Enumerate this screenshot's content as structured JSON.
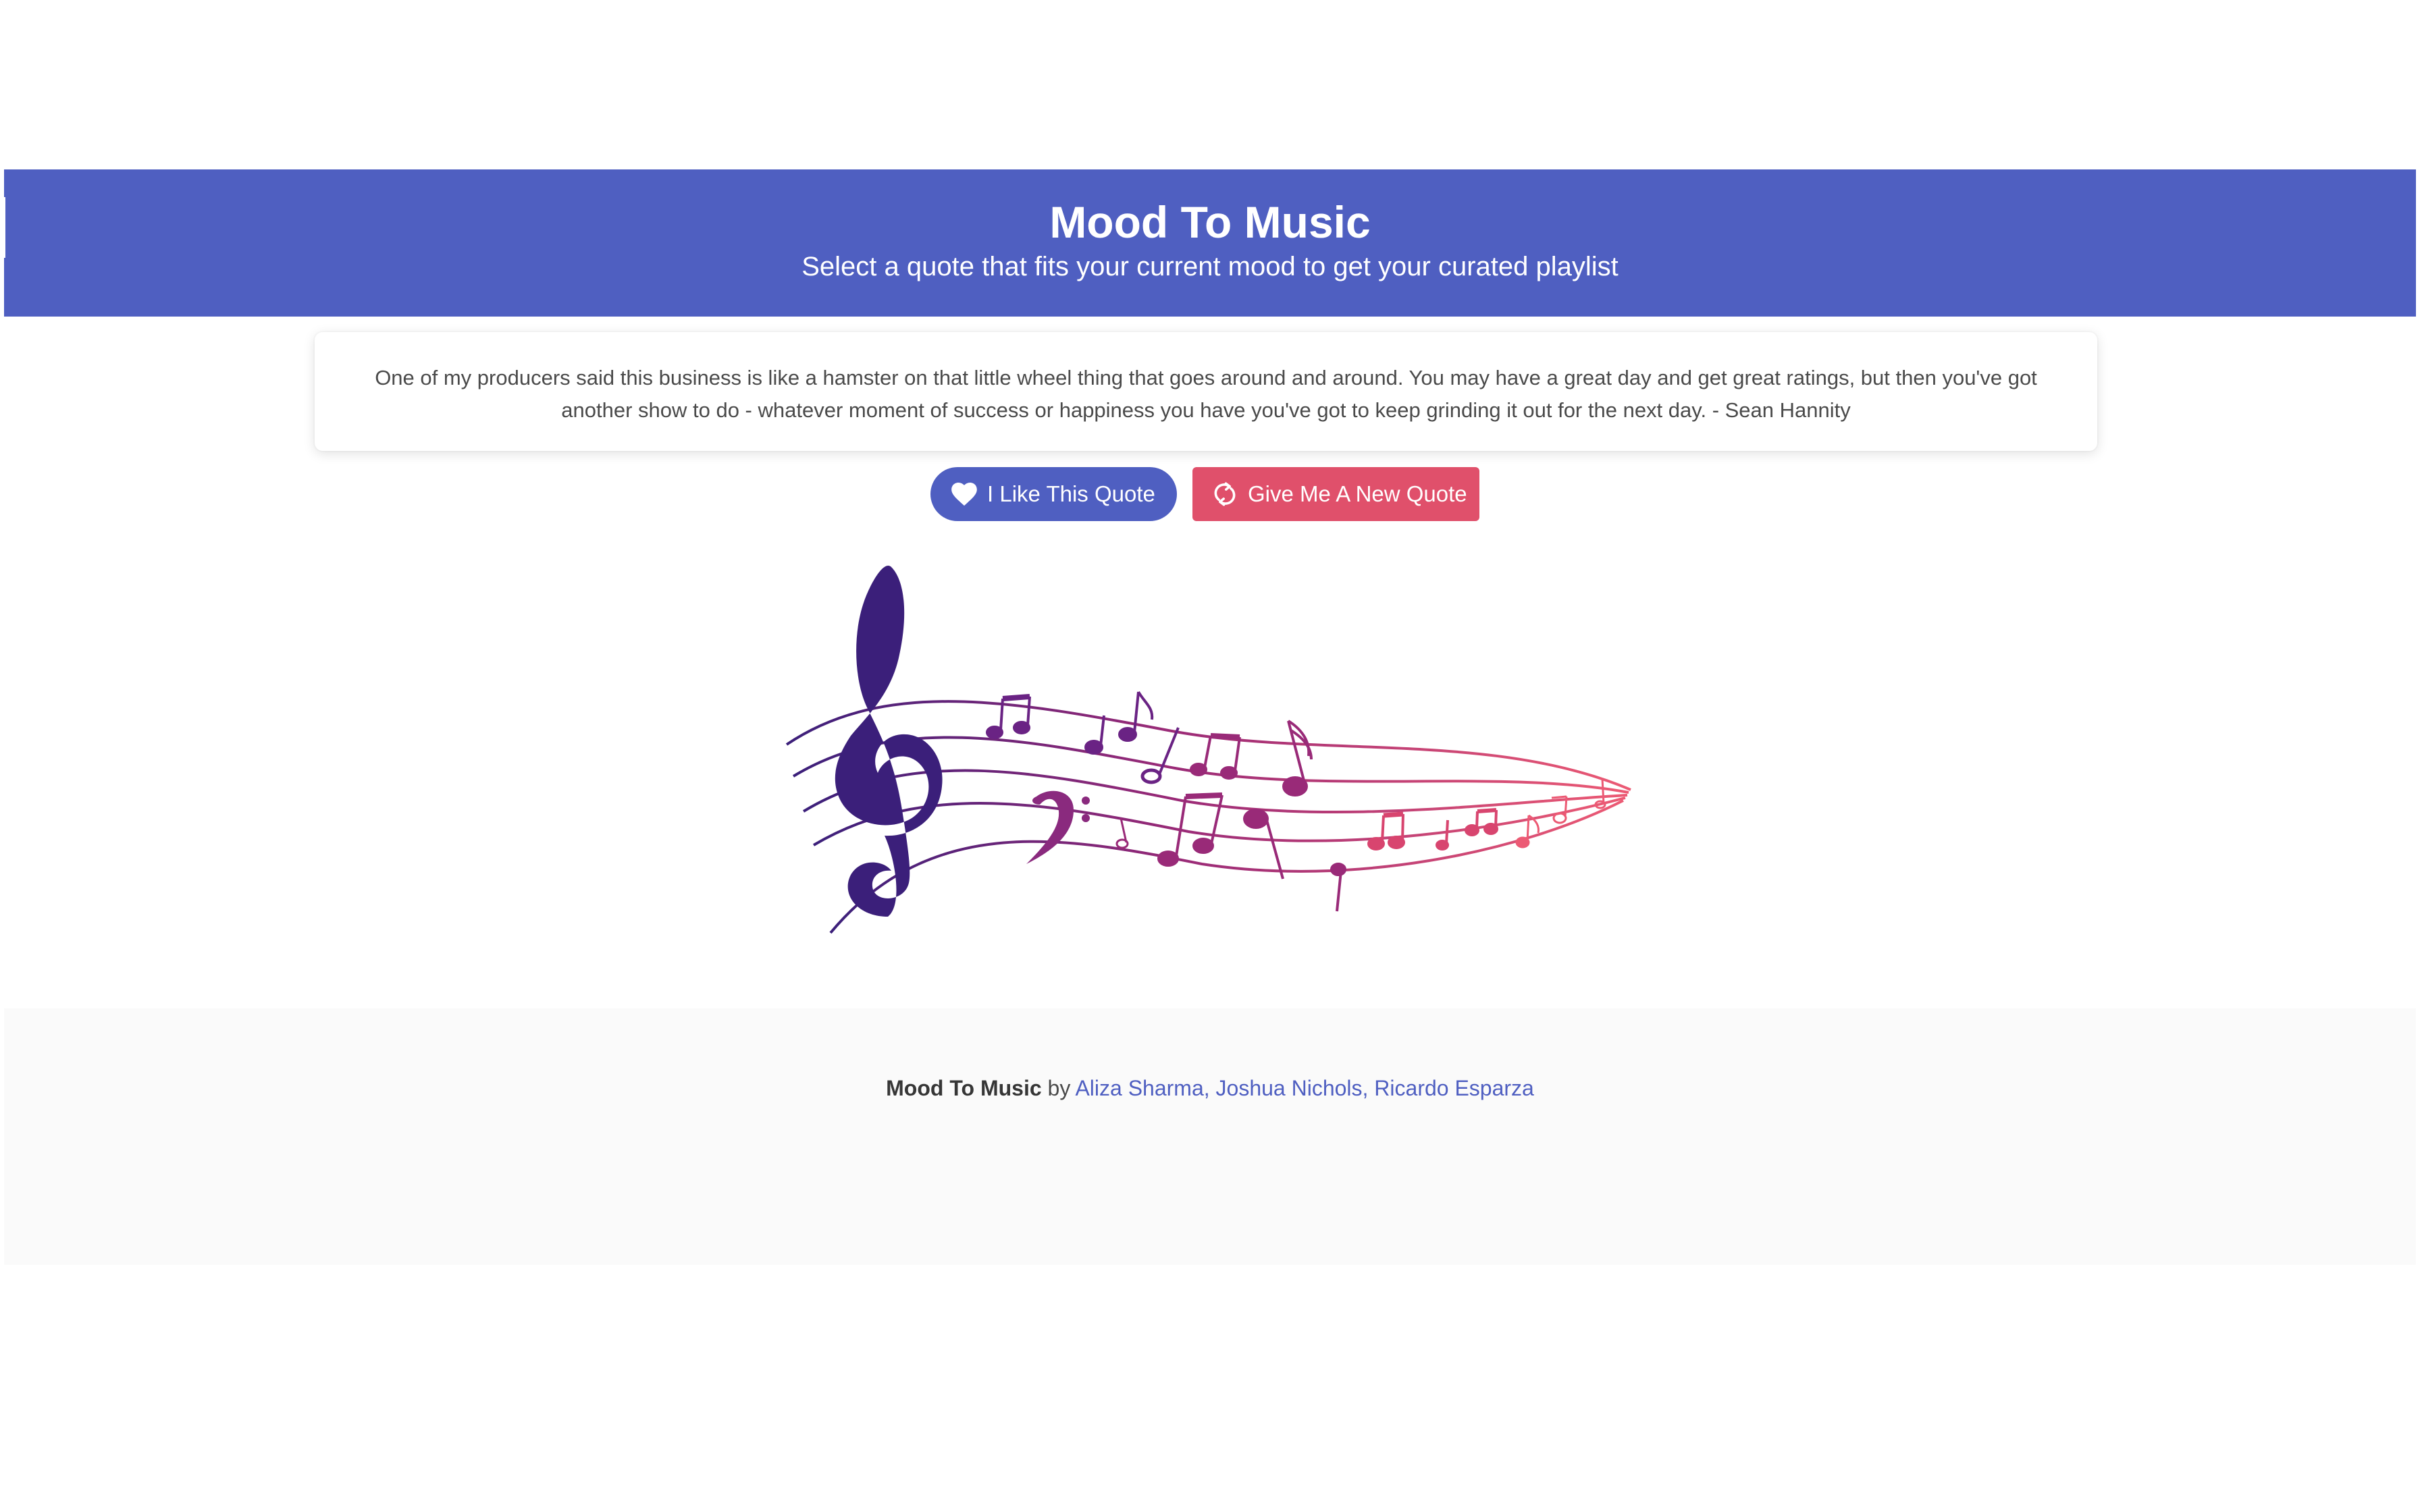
{
  "hero": {
    "title": "Mood To Music",
    "subtitle": "Select a quote that fits your current mood to get your curated playlist",
    "background_color": "#4f5fc1"
  },
  "quote": {
    "text": "One of my producers said this business is like a hamster on that little wheel thing that goes around and around. You may have a great day and get great ratings, but then you've got another show to do - whatever moment of success or happiness you have you've got to keep grinding it out for the next day. - Sean Hannity"
  },
  "actions": {
    "like_label": "I Like This Quote",
    "like_icon": "heart-icon",
    "like_color": "#4f5fc1",
    "new_label": "Give Me A New Quote",
    "new_icon": "refresh-icon",
    "new_color": "#e0506b"
  },
  "illustration": {
    "name": "music-staff-illustration",
    "gradient_start": "#3b1f7a",
    "gradient_end": "#ec4f6e"
  },
  "footer": {
    "app_name": "Mood To Music",
    "by": "by",
    "authors": "Aliza Sharma, Joshua Nichols, Ricardo Esparza"
  }
}
